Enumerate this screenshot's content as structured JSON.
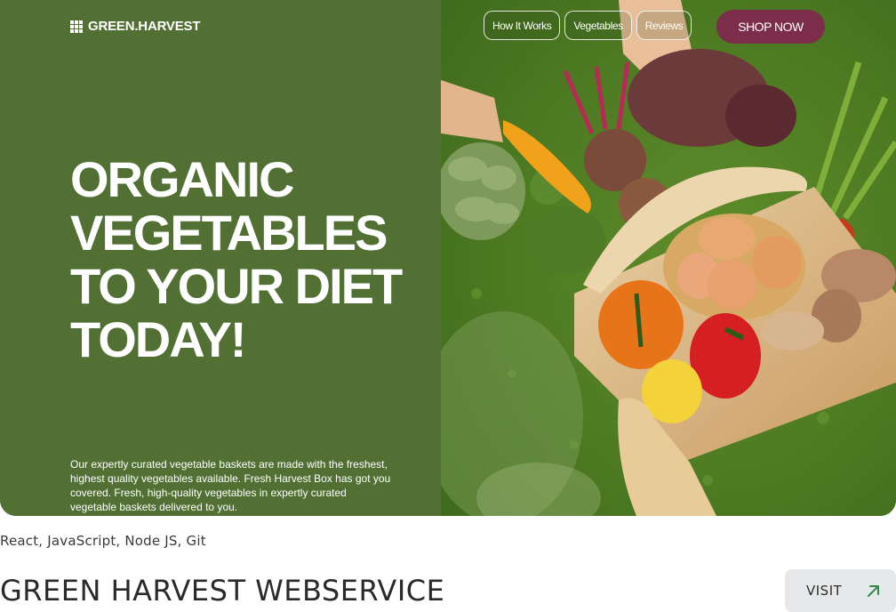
{
  "brand": {
    "logo_text": "GREEN.HARVEST",
    "logo_icon": "grid-icon"
  },
  "nav": {
    "items": [
      {
        "label": "How It Works"
      },
      {
        "label": "Vegetables"
      },
      {
        "label": "Reviews"
      }
    ],
    "cta_label": "SHOP NOW"
  },
  "hero": {
    "headline_lines": [
      "ORGANIC",
      "VEGETABLES",
      "TO YOUR DIET",
      "TODAY!"
    ],
    "description": "Our expertly curated vegetable baskets are made with the freshest, highest quality vegetables available. Fresh Harvest Box has got you covered. Fresh, high-quality vegetables in expertly curated vegetable baskets delivered to you.",
    "image": "vegetable-basket-photo"
  },
  "project": {
    "tech_stack": "React, JavaScript, Node JS, Git",
    "title": "GREEN HARVEST WEBSERVICE",
    "visit_label": "VISIT",
    "visit_icon": "arrow-up-right-icon"
  },
  "colors": {
    "panel_green": "#527034",
    "cta_maroon": "#7b2d4a",
    "visit_bg": "#e6e8ea",
    "arrow_green": "#2f8a4a"
  }
}
